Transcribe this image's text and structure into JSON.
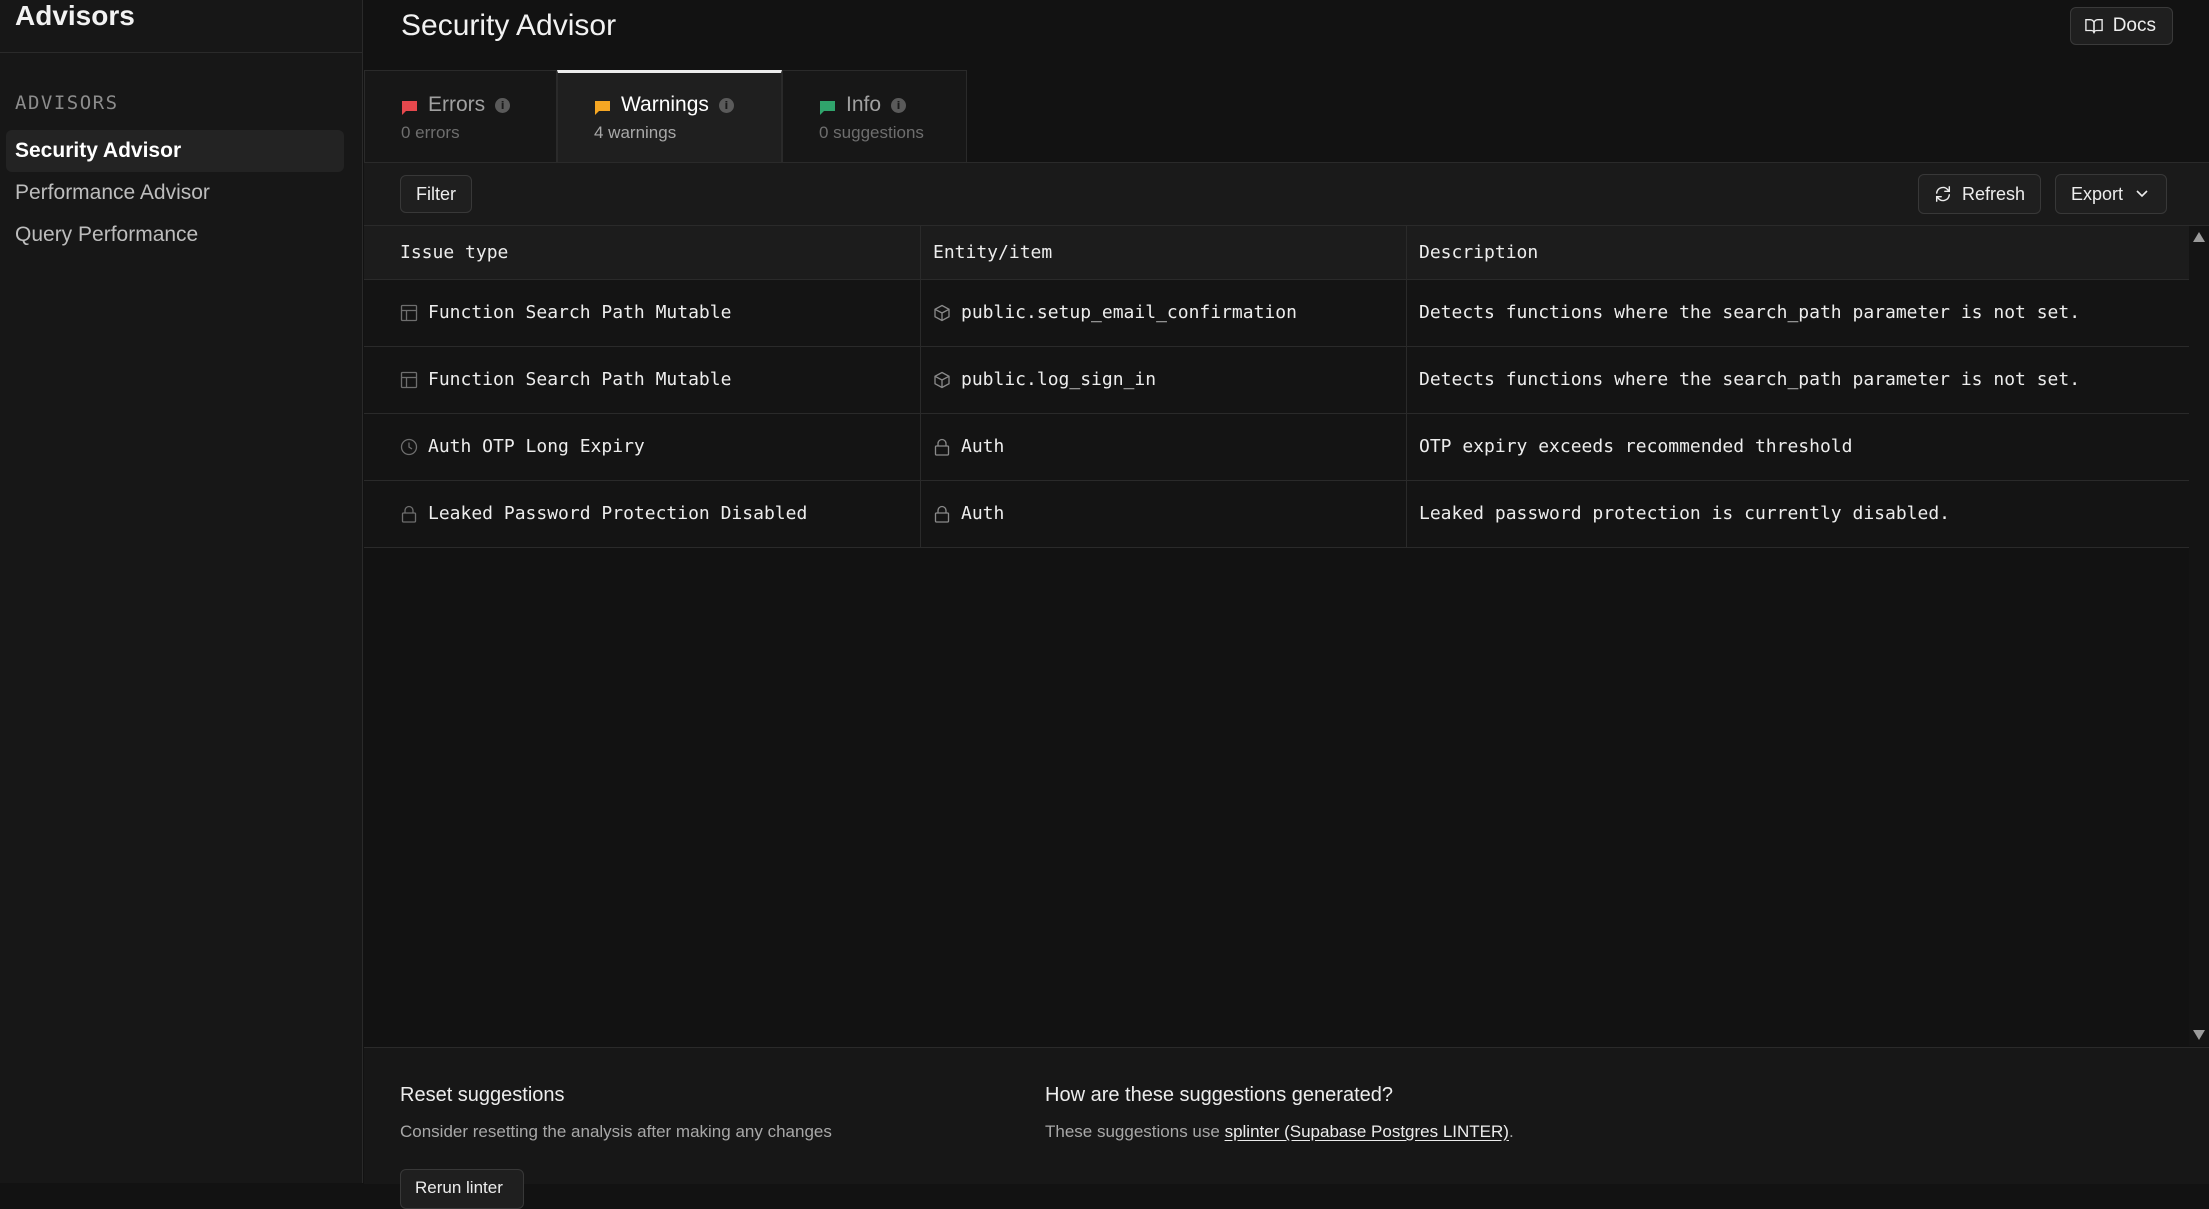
{
  "sidebar": {
    "title": "Advisors",
    "section": "ADVISORS",
    "items": [
      {
        "label": "Security Advisor"
      },
      {
        "label": "Performance Advisor"
      },
      {
        "label": "Query Performance"
      }
    ]
  },
  "header": {
    "title": "Security Advisor",
    "docs_label": "Docs"
  },
  "tabs": [
    {
      "label": "Errors",
      "sub": "0 errors",
      "color": "#e5484d"
    },
    {
      "label": "Warnings",
      "sub": "4 warnings",
      "color": "#f5a623"
    },
    {
      "label": "Info",
      "sub": "0 suggestions",
      "color": "#30a46c"
    }
  ],
  "toolbar": {
    "filter_label": "Filter",
    "refresh_label": "Refresh",
    "export_label": "Export"
  },
  "table": {
    "headers": [
      "Issue type",
      "Entity/item",
      "Description"
    ],
    "rows": [
      {
        "issue_icon": "table-icon",
        "issue": "Function Search Path Mutable",
        "entity_icon": "cube-icon",
        "entity": "public.setup_email_confirmation",
        "description": "Detects functions where the search_path parameter is not set."
      },
      {
        "issue_icon": "table-icon",
        "issue": "Function Search Path Mutable",
        "entity_icon": "cube-icon",
        "entity": "public.log_sign_in",
        "description": "Detects functions where the search_path parameter is not set."
      },
      {
        "issue_icon": "clock-icon",
        "issue": "Auth OTP Long Expiry",
        "entity_icon": "lock-icon",
        "entity": "Auth",
        "description": "OTP expiry exceeds recommended threshold"
      },
      {
        "issue_icon": "lock-icon",
        "issue": "Leaked Password Protection Disabled",
        "entity_icon": "lock-icon",
        "entity": "Auth",
        "description": "Leaked password protection is currently disabled."
      }
    ]
  },
  "footer": {
    "reset_title": "Reset suggestions",
    "reset_text": "Consider resetting the analysis after making any changes",
    "reset_button": "Rerun linter",
    "how_title": "How are these suggestions generated?",
    "how_text_prefix": "These suggestions use ",
    "how_link": "splinter (Supabase Postgres LINTER)",
    "how_text_suffix": "."
  }
}
